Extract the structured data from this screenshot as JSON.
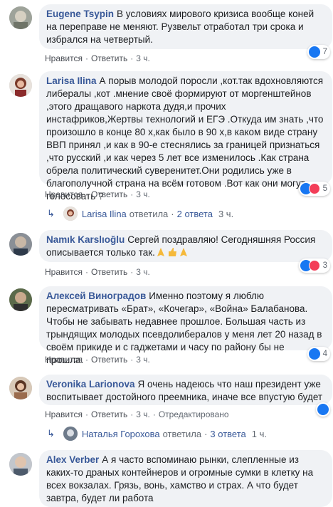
{
  "actions": {
    "like": "Нравится",
    "reply": "Ответить",
    "sep": "·"
  },
  "colors": {
    "author": "#385898",
    "bubble": "#f0f2f5",
    "like": "#1877f2",
    "love": "#f33e58"
  },
  "comments": [
    {
      "author": "Eugene Tsypin",
      "text": "В условиях мирового кризиса вообще коней на переправе не меняют. Рузвельт отработал три срока и избрался на четвертый.",
      "time": "3 ч.",
      "reactions": {
        "icons": [
          "like-icon"
        ],
        "count": "7"
      }
    },
    {
      "author": "Larisa Ilina",
      "text": "А порыв молодой поросли ,кот.так вдохновляются либералы ,кот .мнение своё формируют от моргенштейнов ,этого дращавого наркота дудя,и прочих инстафриков,Жертвы технологий и ЕГЭ .Откуда им знать ,что произошло в конце 80 х,как было в 90 х,в каком виде страну ВВП принял ,и как в 90-е стеснялись за границей признаться ,что русский ,и как через 5 лет все изменилось .Как страна обрела политический суверенитет.Они родились уже в благополучной страна на всём готовом .Вот как они могут голосовать ?",
      "time": "3 ч.",
      "reactions": {
        "icons": [
          "like-icon",
          "love-icon"
        ],
        "count": "5"
      },
      "replies": {
        "author": "Larisa Ilina",
        "verb": "ответила",
        "count": "2 ответа",
        "time": "3 ч."
      }
    },
    {
      "author": "Namık Karslıoğlu",
      "text": "Сергей поздравляю! Сегодняшняя Россия описывается только так.",
      "time": "3 ч.",
      "reactions": {
        "icons": [
          "like-icon",
          "love-icon"
        ],
        "count": "3"
      }
    },
    {
      "author": "Алексей Виноградов",
      "text": "Именно поэтому я люблю пересматривать «Брат», «Кочегар», «Война» Балабанова. Чтобы не забывать недавнее прошлое. Большая часть из трындящих молодых псевдолибералов у меня лет 20 назад в своём прикиде и с гаджетами и часу по району бы не прошла.",
      "time": "3 ч.",
      "reactions": {
        "icons": [
          "like-icon"
        ],
        "count": "4"
      }
    },
    {
      "author": "Veronika Larionova",
      "text": "Я очень надеюсь что наш президент уже воспитывает достойного преемника, иначе все впустую будет",
      "time": "3 ч.",
      "edited": "Отредактировано",
      "reactions": {
        "icons": [
          "like-icon"
        ],
        "count": ""
      },
      "replies": {
        "author": "Наталья Горохова",
        "verb": "ответила",
        "count": "3 ответа",
        "time": "1 ч."
      }
    },
    {
      "author": "Alex Verber",
      "text": "А я часто вспоминаю рынки, слепленные из каких-то драных контейнеров и огромные сумки в клетку на всех вокзалах. Грязь, вонь, хамство и страх. А что будет завтра, будет ли работа",
      "time": "",
      "reactions": {
        "icons": [],
        "count": ""
      }
    }
  ]
}
